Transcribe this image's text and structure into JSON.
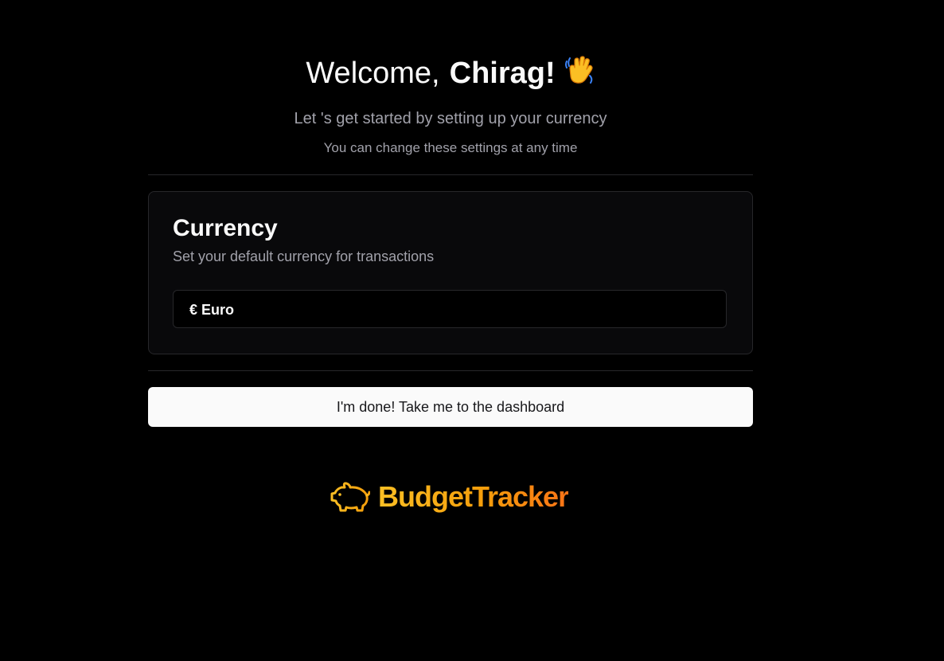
{
  "header": {
    "greeting": "Welcome,",
    "user_name": "Chirag!",
    "wave_icon": "waving-hand-icon",
    "subtitle": "Let 's get started by setting up your currency",
    "note": "You can change these settings at any time"
  },
  "currency_card": {
    "title": "Currency",
    "description": "Set your default currency for transactions",
    "selected_value": "€ Euro"
  },
  "actions": {
    "done_label": "I'm done! Take me to the dashboard"
  },
  "brand": {
    "logo_icon": "piggy-bank-icon",
    "name": "BudgetTracker",
    "color_start": "#fbbf24",
    "color_end": "#f97316"
  },
  "theme": {
    "background": "#000000",
    "card_background": "#09090b",
    "border": "#27272a",
    "muted_text": "#a1a1aa",
    "button_background": "#fafafa"
  }
}
